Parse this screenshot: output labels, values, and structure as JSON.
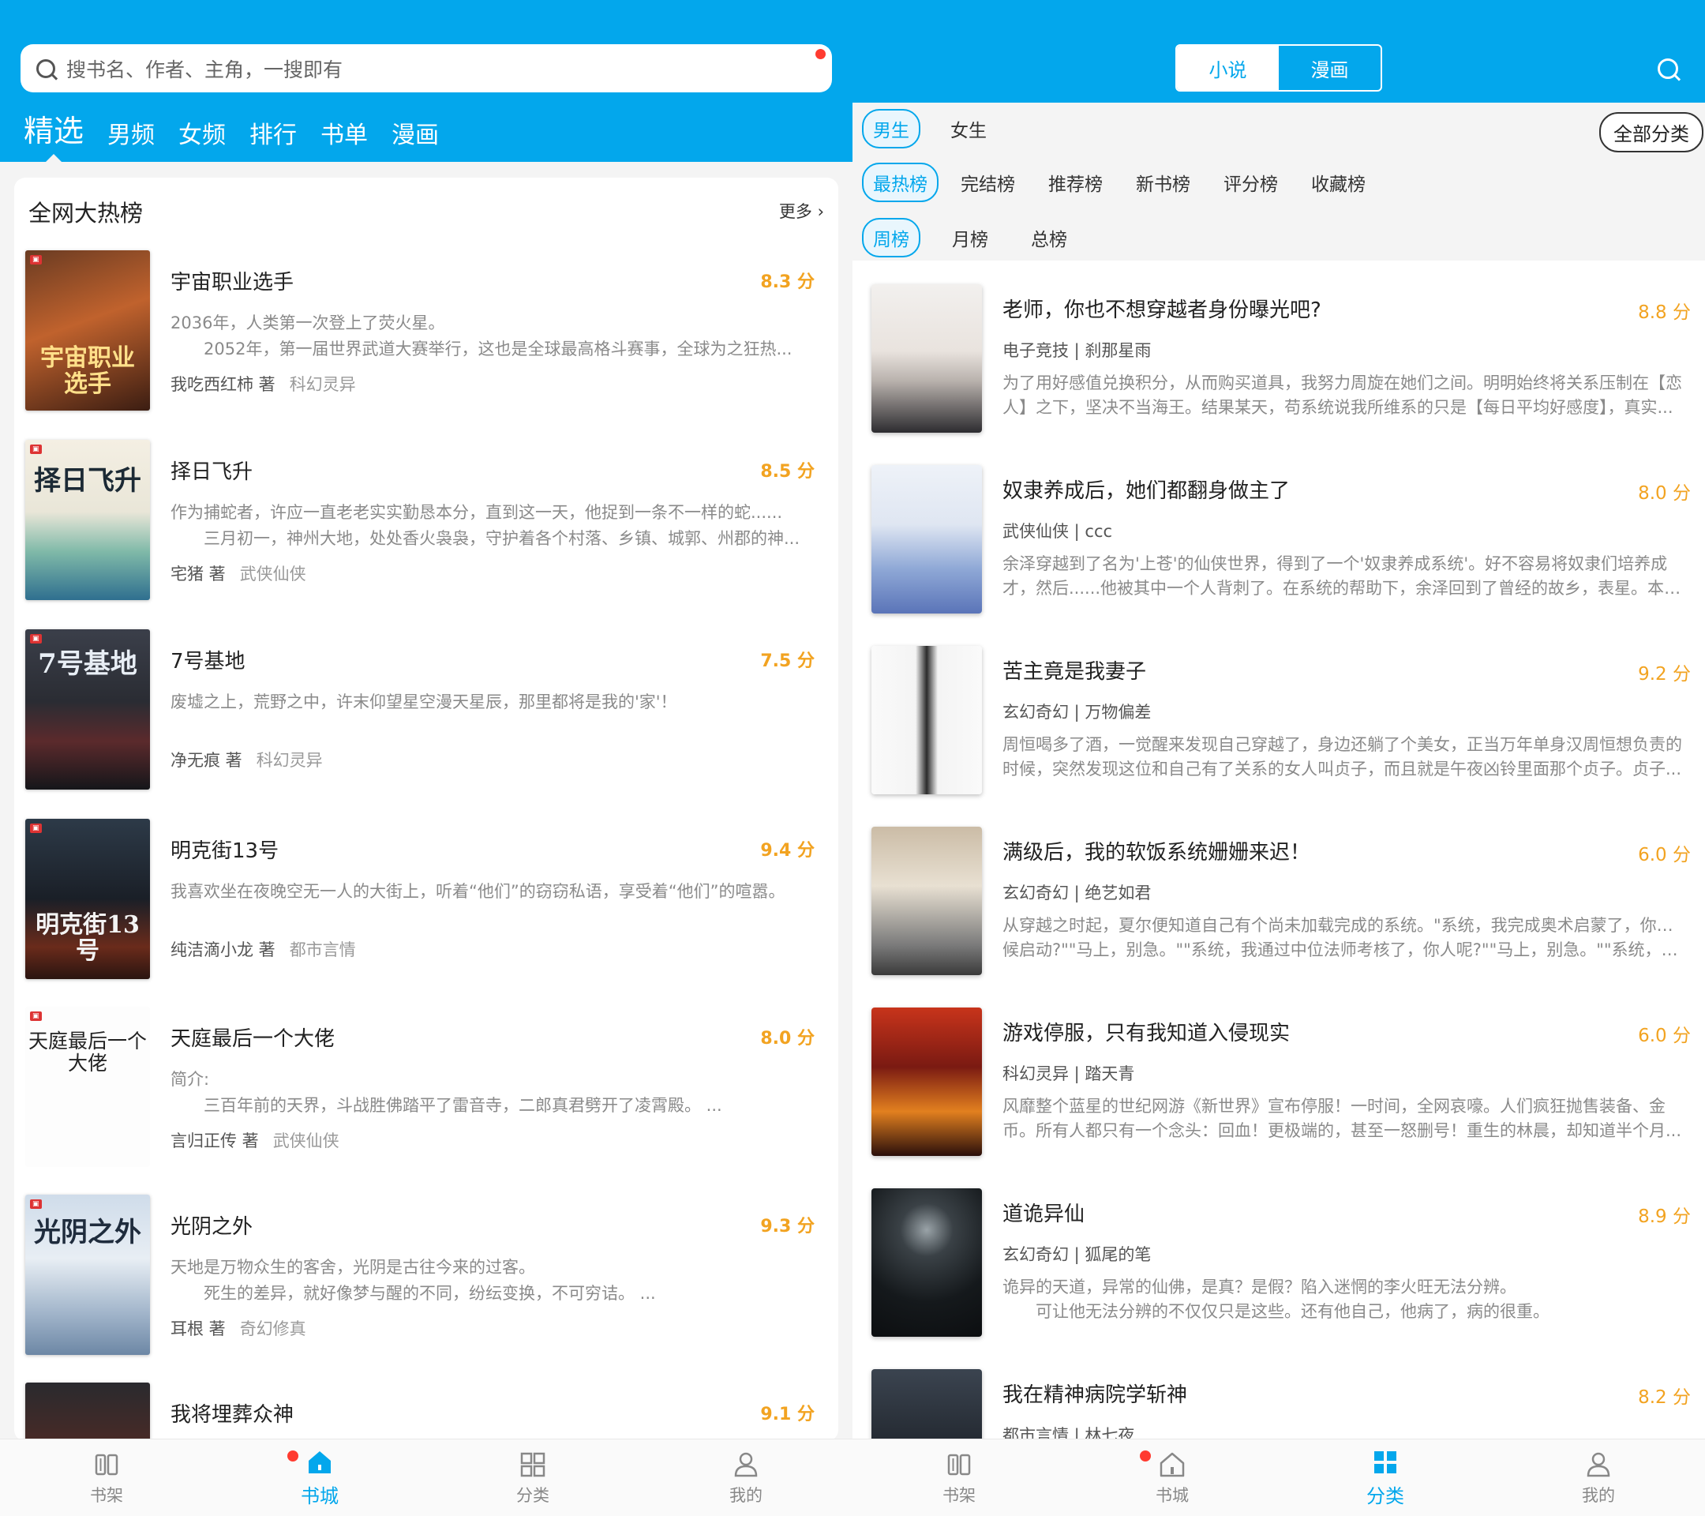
{
  "colors": {
    "brand": "#03a7ec",
    "score": "#f2a321",
    "badge": "#ff3b30"
  },
  "left": {
    "search": {
      "placeholder": "搜书名、作者、主角，一搜即有"
    },
    "tabs": [
      "精选",
      "男频",
      "女频",
      "排行",
      "书单",
      "漫画"
    ],
    "section": {
      "title": "全网大热榜",
      "more": "更多 ›"
    },
    "books": [
      {
        "title": "宇宙职业选手",
        "score": "8.3 分",
        "desc": [
          "2036年，人类第一次登上了荧火星。",
          "　　2052年，第一届世界武道大赛举行，这也是全球最高格斗赛事，全球为之狂热..."
        ],
        "author": "我吃西红柿 著",
        "category": "科幻灵异",
        "cover_text": "宇宙职业选手"
      },
      {
        "title": "择日飞升",
        "score": "8.5 分",
        "desc": [
          "作为捕蛇者，许应一直老老实实勤恳本分，直到这一天，他捉到一条不一样的蛇......",
          "　　三月初一，神州大地，处处香火袅袅，守护着各个村落、乡镇、城郭、州郡的神..."
        ],
        "author": "宅猪 著",
        "category": "武侠仙侠",
        "cover_text": "择日飞升"
      },
      {
        "title": "7号基地",
        "score": "7.5 分",
        "desc": [
          "废墟之上，荒野之中，许末仰望星空漫天星辰，那里都将是我的'家'！"
        ],
        "author": "净无痕 著",
        "category": "科幻灵异",
        "cover_text": "7号基地"
      },
      {
        "title": "明克街13号",
        "score": "9.4 分",
        "desc": [
          "我喜欢坐在夜晚空无一人的大街上，听着“他们”的窃窃私语，享受着“他们”的喧嚣。"
        ],
        "author": "纯洁滴小龙 著",
        "category": "都市言情",
        "cover_text": "明克街13号"
      },
      {
        "title": "天庭最后一个大佬",
        "score": "8.0 分",
        "desc": [
          "简介:",
          "　　三百年前的天界，斗战胜佛踏平了雷音寺，二郎真君劈开了凌霄殿。 ..."
        ],
        "author": "言归正传 著",
        "category": "武侠仙侠",
        "cover_text": "天庭最后一个大佬"
      },
      {
        "title": "光阴之外",
        "score": "9.3 分",
        "desc": [
          "天地是万物众生的客舍，光阴是古往今来的过客。",
          "　　死生的差异，就好像梦与醒的不同，纷纭变换，不可穷诘。 ..."
        ],
        "author": "耳根 著",
        "category": "奇幻修真",
        "cover_text": "光阴之外"
      },
      {
        "title": "我将埋葬众神",
        "score": "9.1 分",
        "desc": [],
        "author": "",
        "category": "",
        "cover_text": ""
      }
    ],
    "nav": [
      {
        "label": "书架",
        "icon": "bookshelf-icon",
        "active": false
      },
      {
        "label": "书城",
        "icon": "home-icon",
        "active": true,
        "badge": true
      },
      {
        "label": "分类",
        "icon": "category-icon",
        "active": false
      },
      {
        "label": "我的",
        "icon": "user-icon",
        "active": false
      }
    ]
  },
  "right": {
    "segment": [
      "小说",
      "漫画"
    ],
    "gender": [
      "男生",
      "女生"
    ],
    "all_categories": "全部分类",
    "rank_types": [
      "最热榜",
      "完结榜",
      "推荐榜",
      "新书榜",
      "评分榜",
      "收藏榜"
    ],
    "periods": [
      "周榜",
      "月榜",
      "总榜"
    ],
    "books": [
      {
        "title": "老师，你也不想穿越者身份曝光吧?",
        "score": "8.8 分",
        "meta": "电子竞技 | 刹那星雨",
        "desc": [
          "为了用好感值兑换积分，从而购买道具，我努力周旋在她们之间。明明始终将关系压制在【恋",
          "人】之下，坚决不当海王。结果某天，苟系统说我所维系的只是【每日平均好感度】，真实..."
        ]
      },
      {
        "title": "奴隶养成后，她们都翻身做主了",
        "score": "8.0 分",
        "meta": "武侠仙侠 | ccc",
        "desc": [
          "余泽穿越到了名为'上苍'的仙侠世界，得到了一个'奴隶养成系统'。好不容易将奴隶们培养成",
          "才，然后......他被其中一个人背刺了。在系统的帮助下，余泽回到了曾经的故乡，表星。本以..."
        ]
      },
      {
        "title": "苦主竟是我妻子",
        "score": "9.2 分",
        "meta": "玄幻奇幻 | 万物偏差",
        "desc": [
          "周恒喝多了酒，一觉醒来发现自己穿越了，身边还躺了个美女，正当万年单身汉周恒想负责的",
          "时候，突然发现这位和自己有了关系的女人叫贞子，而且就是午夜凶铃里面那个贞子。贞子..."
        ]
      },
      {
        "title": "满级后，我的软饭系统姗姗来迟！",
        "score": "6.0 分",
        "meta": "玄幻奇幻 | 绝艺如君",
        "desc": [
          "从穿越之时起，夏尔便知道自己有个尚未加载完成的系统。\"系统，我完成奥术启蒙了，你啥时",
          "候启动?\"\"马上，别急。\"\"系统，我通过中位法师考核了，你人呢?\"\"马上，别急。\"\"系统，我晋..."
        ]
      },
      {
        "title": "游戏停服，只有我知道入侵现实",
        "score": "6.0 分",
        "meta": "科幻灵异 | 踏天青",
        "desc": [
          "风靡整个蓝星的世纪网游《新世界》宣布停服！一时间，全网哀嚎。人们疯狂抛售装备、金",
          "币。所有人都只有一个念头：回血！更极端的，甚至一怒删号！重生的林晨，却知道半个月..."
        ]
      },
      {
        "title": "道诡异仙",
        "score": "8.9 分",
        "meta": "玄幻奇幻 | 狐尾的笔",
        "desc": [
          "诡异的天道，异常的仙佛，是真？是假？陷入迷惘的李火旺无法分辨。",
          "　　可让他无法分辨的不仅仅只是这些。还有他自己，他病了，病的很重。"
        ]
      },
      {
        "title": "我在精神病院学斩神",
        "score": "8.2 分",
        "meta": "都市言情 | 林七夜",
        "desc": []
      }
    ],
    "nav": [
      {
        "label": "书架",
        "icon": "bookshelf-icon",
        "active": false
      },
      {
        "label": "书城",
        "icon": "home-icon",
        "active": false,
        "badge": true
      },
      {
        "label": "分类",
        "icon": "category-icon",
        "active": true
      },
      {
        "label": "我的",
        "icon": "user-icon",
        "active": false
      }
    ]
  }
}
